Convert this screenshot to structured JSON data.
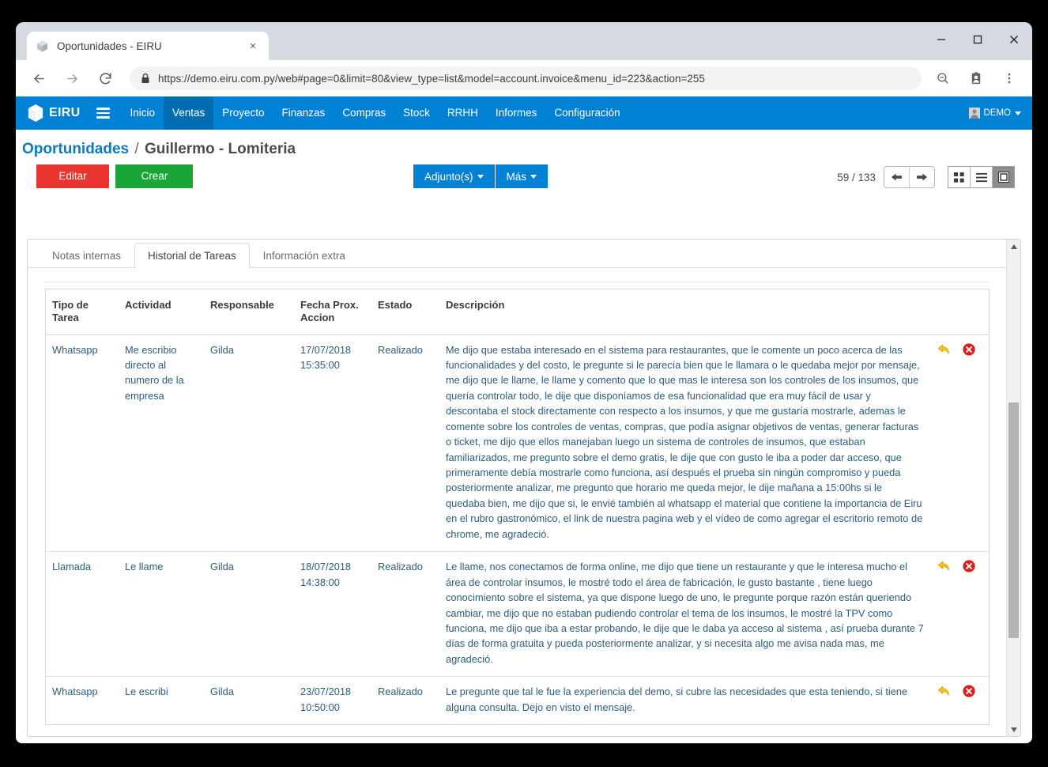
{
  "browser": {
    "tab_title": "Oportunidades - EIRU",
    "tab_favicon": "cube-icon",
    "tab_close": "×",
    "window_minimize": "—",
    "window_maximize": "□",
    "window_close": "✕",
    "back": "←",
    "forward": "→",
    "reload": "⟳",
    "url": "https://demo.eiru.com.py/web#page=0&limit=80&view_type=list&model=account.invoice&menu_id=223&action=255",
    "url_scheme": "https://",
    "url_rest": "demo.eiru.com.py/web#page=0&limit=80&view_type=list&model=account.invoice&menu_id=223&action=255",
    "zoom_icon": "zoom-out-icon",
    "profile_icon": "profile-badge-icon",
    "menu_icon": "three-dots-menu-icon"
  },
  "navbar": {
    "brand": "EIRU",
    "menu_toggle": "hamburger-icon",
    "items": [
      {
        "label": "Inicio",
        "active": false
      },
      {
        "label": "Ventas",
        "active": true
      },
      {
        "label": "Proyecto",
        "active": false
      },
      {
        "label": "Finanzas",
        "active": false
      },
      {
        "label": "Compras",
        "active": false
      },
      {
        "label": "Stock",
        "active": false
      },
      {
        "label": "RRHH",
        "active": false
      },
      {
        "label": "Informes",
        "active": false
      },
      {
        "label": "Configuración",
        "active": false
      }
    ],
    "user": "DEMO",
    "accent_color": "#0081d4",
    "active_color": "#006cb2"
  },
  "breadcrumb": {
    "root": "Oportunidades",
    "separator": "/",
    "current": "Guillermo - Lomiteria"
  },
  "actions": {
    "edit_label": "Editar",
    "create_label": "Crear",
    "edit_color": "#e8332e",
    "create_color": "#19a637",
    "attachments_label": "Adjunto(s)",
    "more_label": "Más"
  },
  "pager": {
    "count_text": "59 / 133",
    "prev": "⬅",
    "next": "➡",
    "view_kanban": "kanban-view-icon",
    "view_list": "list-view-icon",
    "view_form": "form-view-icon",
    "active_view": "form"
  },
  "tabs": [
    {
      "label": "Notas internas",
      "active": false
    },
    {
      "label": "Historial de Tareas",
      "active": true
    },
    {
      "label": "Información extra",
      "active": false
    }
  ],
  "table": {
    "headers": [
      "Tipo de Tarea",
      "Actividad",
      "Responsable",
      "Fecha Prox. Accion",
      "Estado",
      "Descripción"
    ],
    "rows": [
      {
        "tipo": "Whatsapp",
        "actividad": "Me escribio directo al numero de la empresa",
        "responsable": "Gilda",
        "fecha": "17/07/2018 15:35:00",
        "estado": "Realizado",
        "descripcion": "Me dijo que estaba interesado en el sistema para restaurantes, que le comente un poco acerca de las funcionalidades y del costo, le pregunte si le parecía bien que le llamara o le quedaba mejor por mensaje, me dijo que le llame, le llame y comento que lo que mas le interesa son los controles de los insumos, que quería controlar todo, le dije que disponíamos de esa funcionalidad que era muy fácil de usar y descontaba el stock directamente con respecto a los insumos, y que me gustaría mostrarle, ademas le comente sobre los controles de ventas, compras, que podía asignar objetivos de ventas, generar facturas o ticket, me dijo que ellos manejaban luego un sistema de controles de insumos, que estaban familiarizados, me pregunto sobre el demo gratis, le dije que con gusto le iba a poder dar acceso, que primeramente debía mostrarle como funciona, así después el prueba sin ningún compromiso y pueda posteriormente analizar, me pregunto que horario me queda mejor, le dije mañana a 15:00hs si le quedaba bien, me dijo que si, le envié también al whatsapp el material que contiene la importancia de Eiru en el rubro gastronómico, el link de nuestra pagina web y el vídeo de como agregar el escritorio remoto de chrome, me agradeció.",
        "reply_icon": "reply-arrow-icon",
        "delete_icon": "delete-circle-icon"
      },
      {
        "tipo": "Llamada",
        "actividad": "Le llame",
        "responsable": "Gilda",
        "fecha": "18/07/2018 14:38:00",
        "estado": "Realizado",
        "descripcion": "Le llame, nos conectamos de forma online, me dijo que tiene un restaurante y que le interesa mucho el área de controlar insumos, le mostré todo el área de fabricación, le gusto bastante , tiene luego conocimiento sobre el sistema, ya que dispone luego de uno, le pregunte porque razón están queriendo cambiar, me dijo que no estaban pudiendo controlar el tema de los insumos, le mostré la TPV como funciona, me dijo que iba a estar probando, le dije que le daba ya acceso al sistema , así prueba durante 7 días de forma gratuita y pueda posteriormente analizar, y si necesita algo me avisa nada mas, me agradeció.",
        "reply_icon": "reply-arrow-icon",
        "delete_icon": "delete-circle-icon"
      },
      {
        "tipo": "Whatsapp",
        "actividad": "Le escribi",
        "responsable": "Gilda",
        "fecha": "23/07/2018 10:50:00",
        "estado": "Realizado",
        "descripcion": "Le pregunte que tal le fue la experiencia del demo, si cubre las necesidades que esta teniendo, si tiene alguna consulta. Dejo en visto el mensaje.",
        "reply_icon": "reply-arrow-icon",
        "delete_icon": "delete-circle-icon"
      }
    ]
  }
}
